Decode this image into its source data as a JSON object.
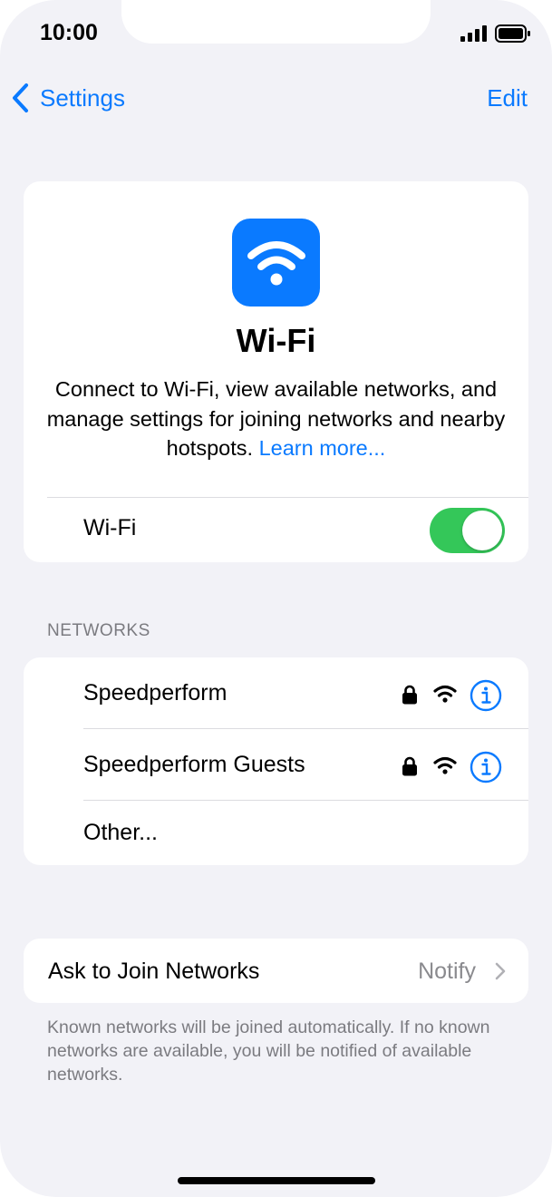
{
  "status_bar": {
    "time": "10:00"
  },
  "nav": {
    "back_label": "Settings",
    "edit_label": "Edit"
  },
  "hero": {
    "title": "Wi-Fi",
    "description": "Connect to Wi-Fi, view available networks, and manage settings for joining networks and nearby hotspots.",
    "learn_more": "Learn more...",
    "toggle_label": "Wi-Fi",
    "toggle_on": true
  },
  "networks": {
    "header": "NETWORKS",
    "items": [
      {
        "name": "Speedperform",
        "secured": true
      },
      {
        "name": "Speedperform Guests",
        "secured": true
      },
      {
        "name": "Other..."
      }
    ]
  },
  "ask_to_join": {
    "label": "Ask to Join Networks",
    "value": "Notify",
    "footer": "Known networks will be joined automatically. If no known networks are available, you will be notified of available networks."
  },
  "colors": {
    "accent": "#0a7aff",
    "toggle_on": "#34c759",
    "background": "#f2f2f7"
  },
  "icons": [
    "back-chevron-icon",
    "wifi-icon",
    "lock-icon",
    "wifi-strength-icon",
    "info-icon",
    "chevron-right-icon",
    "signal-icon",
    "battery-icon"
  ]
}
